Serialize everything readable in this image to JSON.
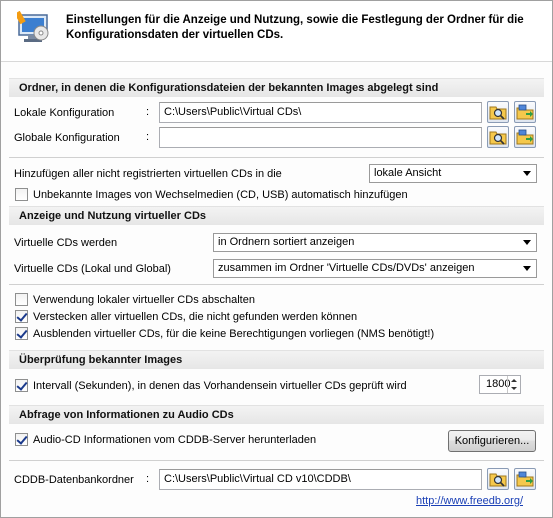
{
  "header": {
    "description": "Einstellungen für die Anzeige und Nutzung, sowie die Festlegung der Ordner für die Konfigurationsdaten der virtuellen CDs."
  },
  "sections": {
    "folders": "Ordner, in denen die Konfigurationsdateien der bekannten Images abgelegt sind",
    "display": "Anzeige und Nutzung virtueller CDs",
    "check": "Überprüfung bekannter Images",
    "audio": "Abfrage von Informationen zu Audio CDs"
  },
  "local_config": {
    "label": "Lokale Konfiguration",
    "colon": ":",
    "value": "C:\\Users\\Public\\Virtual CDs\\"
  },
  "global_config": {
    "label": "Globale Konfiguration",
    "colon": ":",
    "value": ""
  },
  "add_unregistered": {
    "label": "Hinzufügen aller nicht registrierten virtuellen CDs in die",
    "selected": "lokale Ansicht"
  },
  "auto_add_removable": {
    "label": "Unbekannte Images von Wechselmedien (CD, USB) automatisch hinzufügen",
    "checked": false
  },
  "virtual_cds_shown": {
    "label": "Virtuelle CDs werden",
    "selected": "in Ordnern sortiert anzeigen"
  },
  "virtual_cds_local_global": {
    "label": "Virtuelle CDs (Lokal und Global)",
    "selected": "zusammen im Ordner 'Virtuelle CDs/DVDs' anzeigen"
  },
  "disable_local": {
    "label": "Verwendung lokaler virtueller CDs abschalten",
    "checked": false
  },
  "hide_missing": {
    "label": "Verstecken aller virtuellen CDs, die nicht gefunden werden können",
    "checked": true
  },
  "hide_no_permission": {
    "label": "Ausblenden virtueller CDs, für die keine Berechtigungen vorliegen (NMS benötigt!)",
    "checked": true
  },
  "interval": {
    "label": "Intervall (Sekunden), in denen das Vorhandensein virtueller CDs geprüft wird",
    "checked": true,
    "value": "1800"
  },
  "audio_cd": {
    "label": "Audio-CD Informationen vom CDDB-Server herunterladen",
    "checked": true,
    "configure_label": "Konfigurieren..."
  },
  "cddb_folder": {
    "label": "CDDB-Datenbankordner",
    "colon": ":",
    "value": "C:\\Users\\Public\\Virtual CD v10\\CDDB\\"
  },
  "footer": {
    "link": "http://www.freedb.org/"
  },
  "icons": {
    "header": "virtual-cd-settings-icon",
    "browse": "folder-search-icon",
    "network": "network-folder-icon"
  },
  "colors": {
    "link": "#1a3fb5",
    "section_bg": "#e9e9e9"
  }
}
